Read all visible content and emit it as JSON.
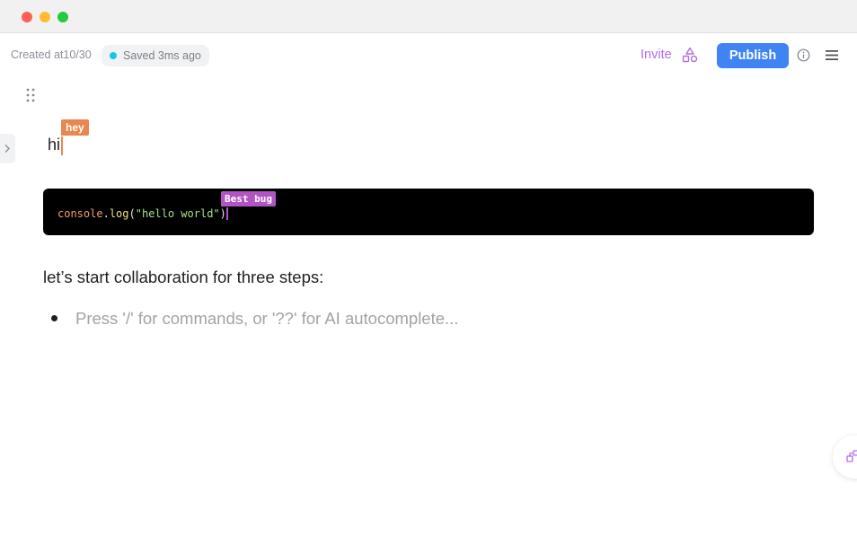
{
  "window": {
    "traffic_lights": {
      "close": "#fe5f57",
      "minimize": "#febc2e",
      "maximize": "#28c840"
    }
  },
  "header": {
    "created_label": "Created at10/30",
    "saved_status": "Saved 3ms ago",
    "saved_dot_color": "#17c5e0",
    "invite_label": "Invite",
    "publish_label": "Publish",
    "icons": [
      "shapes-icon",
      "info-icon",
      "menu-icon"
    ],
    "accent_color": "#3f84f2",
    "invite_color": "#b66ce8"
  },
  "editor": {
    "first_line": "hi",
    "collaborator_cursors": [
      {
        "name": "hey",
        "color": "#e8874e"
      },
      {
        "name": "Best bug",
        "color": "#b254c5"
      }
    ],
    "code_block": {
      "object": "console",
      "dot": ".",
      "method": "log",
      "open": "(",
      "string": "\"hello world\"",
      "close": ")"
    },
    "paragraph": "let’s start collaboration for three steps:",
    "bullet_placeholder": "Press '/' for commands, or '??' for AI autocomplete..."
  }
}
